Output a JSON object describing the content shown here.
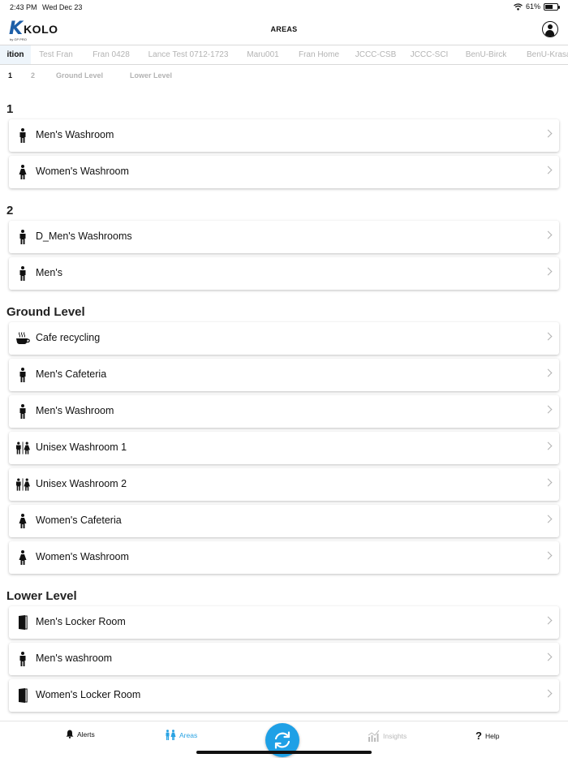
{
  "status_bar": {
    "time": "2:43 PM",
    "date": "Wed Dec 23",
    "battery": "61%",
    "battery_level": 0.61
  },
  "header": {
    "logo_text": "KOLO",
    "logo_subtext": "by GP PRO",
    "title": "AREAS"
  },
  "location_tabs": [
    {
      "label": "ition",
      "active": true
    },
    {
      "label": "Test Fran"
    },
    {
      "label": "Fran 0428"
    },
    {
      "label": "Lance Test 0712-1723"
    },
    {
      "label": "Maru001"
    },
    {
      "label": "Fran Home"
    },
    {
      "label": "JCCC-CSB"
    },
    {
      "label": "JCCC-SCI"
    },
    {
      "label": "BenU-Birck"
    },
    {
      "label": "BenU-Krasa"
    }
  ],
  "floor_tabs": [
    {
      "label": "1",
      "active": true
    },
    {
      "label": "2"
    },
    {
      "label": "Ground Level"
    },
    {
      "label": "Lower Level"
    }
  ],
  "sections": [
    {
      "title": "1",
      "areas": [
        {
          "label": "Men's Washroom",
          "icon": "man-icon"
        },
        {
          "label": "Women's Washroom",
          "icon": "woman-icon"
        }
      ]
    },
    {
      "title": "2",
      "areas": [
        {
          "label": "D_Men's Washrooms",
          "icon": "man-icon"
        },
        {
          "label": "Men's",
          "icon": "man-icon"
        }
      ]
    },
    {
      "title": "Ground Level",
      "areas": [
        {
          "label": "Cafe recycling",
          "icon": "coffee-cup-icon"
        },
        {
          "label": "Men's Cafeteria",
          "icon": "man-icon"
        },
        {
          "label": "Men's Washroom",
          "icon": "man-icon"
        },
        {
          "label": "Unisex Washroom 1",
          "icon": "unisex-icon"
        },
        {
          "label": "Unisex Washroom 2",
          "icon": "unisex-icon"
        },
        {
          "label": "Women's Cafeteria",
          "icon": "woman-icon"
        },
        {
          "label": "Women's Washroom",
          "icon": "woman-icon"
        }
      ]
    },
    {
      "title": "Lower Level",
      "areas": [
        {
          "label": "Men's  Locker Room",
          "icon": "door-icon"
        },
        {
          "label": "Men's washroom",
          "icon": "man-icon"
        },
        {
          "label": "Women's Locker Room",
          "icon": "door-icon"
        }
      ]
    }
  ],
  "tab_bar": {
    "alerts": "Alerts",
    "areas": "Areas",
    "insights": "Insights",
    "help": "Help"
  },
  "colors": {
    "accent": "#1ea0e6",
    "brand": "#1d5fa8"
  }
}
